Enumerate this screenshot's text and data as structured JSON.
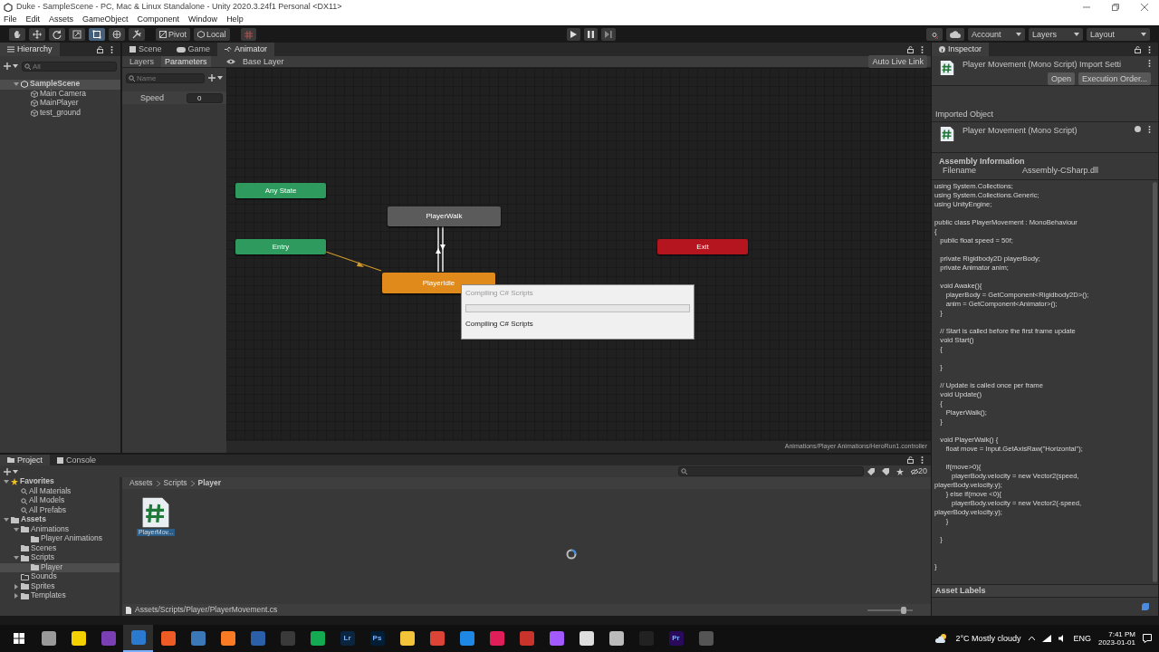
{
  "window": {
    "title": "Duke - SampleScene - PC, Mac & Linux Standalone - Unity 2020.3.24f1 Personal <DX11>"
  },
  "menu": [
    "File",
    "Edit",
    "Assets",
    "GameObject",
    "Component",
    "Window",
    "Help"
  ],
  "toolbar": {
    "tools": [
      {
        "kind": "hand",
        "selected": false
      },
      {
        "kind": "move",
        "selected": false
      },
      {
        "kind": "rotate",
        "selected": false
      },
      {
        "kind": "scale",
        "selected": false
      },
      {
        "kind": "rect",
        "selected": true
      },
      {
        "kind": "transform",
        "selected": false
      },
      {
        "kind": "custom",
        "selected": false
      }
    ],
    "pivot": "Pivot",
    "local": "Local",
    "account": "Account",
    "layers": "Layers",
    "layout": "Layout"
  },
  "hierarchy": {
    "title": "Hierarchy",
    "search_placeholder": "All",
    "items": [
      {
        "label": "SampleScene",
        "kind": "scene",
        "expanded": true,
        "children": [
          {
            "label": "Main Camera",
            "kind": "object"
          },
          {
            "label": "MainPlayer",
            "kind": "object"
          },
          {
            "label": "test_ground",
            "kind": "object"
          }
        ]
      }
    ]
  },
  "scene_tabs": [
    {
      "label": "Scene",
      "kind": "scene",
      "selected": false
    },
    {
      "label": "Game",
      "kind": "game",
      "selected": false
    },
    {
      "label": "Animator",
      "kind": "animator",
      "selected": true
    }
  ],
  "animator": {
    "panel_tabs": [
      {
        "label": "Layers",
        "selected": false
      },
      {
        "label": "Parameters",
        "selected": true
      }
    ],
    "breadcrumb": "Base Layer",
    "live_link": "Auto Live Link",
    "param_placeholder": "Name",
    "parameters": [
      {
        "name": "Speed",
        "value": "0"
      }
    ],
    "states": [
      {
        "label": "Any State",
        "color": "#2f9a5e"
      },
      {
        "label": "PlayerWalk",
        "color": "#5b5b5b"
      },
      {
        "label": "Entry",
        "color": "#2f9a5e"
      },
      {
        "label": "Exit",
        "color": "#b4151f"
      },
      {
        "label": "PlayerIdle",
        "color": "#e08a1c"
      }
    ],
    "path": "Animations/Player Animations/HeroRun1.controller"
  },
  "dialog": {
    "title": "Compiling C# Scripts",
    "level": 0,
    "message": "Compiling C# Scripts"
  },
  "inspector": {
    "title": "Inspector",
    "header": "Player Movement (Mono Script) Import Setti",
    "buttons": [
      "Open",
      "Execution Order..."
    ],
    "section": "Imported Object",
    "object": "Player Movement (Mono Script)",
    "assembly_title": "Assembly Information",
    "filename_label": "Filename",
    "filename": "Assembly-CSharp.dll",
    "code": "using System.Collections;\nusing System.Collections.Generic;\nusing UnityEngine;\n\npublic class PlayerMovement : MonoBehaviour\n{\n   public float speed = 50f;\n\n   private Rigidbody2D playerBody;\n   private Animator anim;\n\n   void Awake(){\n      playerBody = GetComponent<Rigidbody2D>();\n      anim = GetComponent<Animator>();\n   }\n\n   // Start is called before the first frame update\n   void Start()\n   {\n\n   }\n\n   // Update is called once per frame\n   void Update()\n   {\n      PlayerWalk();\n   }\n\n   void PlayerWalk() {\n      float move = Input.GetAxisRaw(\"Horizontal\");\n\n      if(move>0){\n         playerBody.velocity = new Vector2(speed,\nplayerBody.velocity.y);\n      } else if(move <0){\n         playerBody.velocity = new Vector2(-speed,\nplayerBody.velocity.y);\n      }\n\n   }\n\n\n}",
    "labels_title": "Asset Labels"
  },
  "project": {
    "tabs": [
      {
        "label": "Project",
        "kind": "project",
        "selected": true
      },
      {
        "label": "Console",
        "kind": "console",
        "selected": false
      }
    ],
    "hidden_count": "20",
    "tree": [
      {
        "label": "Favorites",
        "kind": "favorites",
        "expanded": true,
        "selected": false,
        "children": [
          {
            "label": "All Materials",
            "kind": "search",
            "selected": false
          },
          {
            "label": "All Models",
            "kind": "search",
            "selected": false
          },
          {
            "label": "All Prefabs",
            "kind": "search",
            "selected": false
          }
        ]
      },
      {
        "label": "Assets",
        "kind": "folder",
        "expanded": true,
        "selected": false,
        "children": [
          {
            "label": "Animations",
            "kind": "folder",
            "expanded": true,
            "selected": false,
            "children": [
              {
                "label": "Player Animations",
                "kind": "folder",
                "selected": false
              }
            ]
          },
          {
            "label": "Scenes",
            "kind": "folder",
            "selected": false
          },
          {
            "label": "Scripts",
            "kind": "folder",
            "expanded": true,
            "selected": false,
            "children": [
              {
                "label": "Player",
                "kind": "folder",
                "selected": true
              }
            ]
          },
          {
            "label": "Sounds",
            "kind": "empty-folder",
            "selected": false
          },
          {
            "label": "Sprites",
            "kind": "folder",
            "expanded": false,
            "selected": false
          },
          {
            "label": "Templates",
            "kind": "folder",
            "expanded": false,
            "selected": false
          }
        ]
      }
    ],
    "breadcrumb": [
      "Assets",
      "Scripts",
      "Player"
    ],
    "files": [
      {
        "name": "PlayerMov...",
        "selected": true
      }
    ],
    "status": "Assets/Scripts/Player/PlayerMovement.cs",
    "zoom": {
      "level": 0.85
    }
  },
  "taskbar": {
    "apps": [
      {
        "color": "#9a9a9a",
        "active": false
      },
      {
        "color": "#f5d000",
        "active": false
      },
      {
        "color": "#7b3fb5",
        "active": false
      },
      {
        "color": "#2a7bd0",
        "active": true
      },
      {
        "color": "#ef5b25",
        "active": false
      },
      {
        "color": "#3b78b8",
        "active": false
      },
      {
        "color": "#fb7a24",
        "active": false
      },
      {
        "color": "#2b5fa8",
        "active": false
      },
      {
        "color": "#3a3a3a",
        "active": false
      },
      {
        "color": "#13aa52",
        "active": false
      },
      {
        "color": "#0a2540",
        "label": "Lr",
        "active": false
      },
      {
        "color": "#001e36",
        "label": "Ps",
        "active": false
      },
      {
        "color": "#f3c33a",
        "active": false
      },
      {
        "color": "#db4437",
        "active": false
      },
      {
        "color": "#1e88e5",
        "active": false
      },
      {
        "color": "#e01e5a",
        "active": false
      },
      {
        "color": "#c8342b",
        "active": false
      },
      {
        "color": "#a259ff",
        "active": false
      },
      {
        "color": "#dddddd",
        "active": false
      },
      {
        "color": "#bbbbbb",
        "active": false
      },
      {
        "color": "#222222",
        "active": false
      },
      {
        "color": "#2a0a5a",
        "label": "Pr",
        "active": false
      },
      {
        "color": "#555555",
        "active": false
      }
    ],
    "weather": "2°C Mostly cloudy",
    "language": "ENG",
    "time": "7:41 PM",
    "date": "2023-01-01"
  }
}
